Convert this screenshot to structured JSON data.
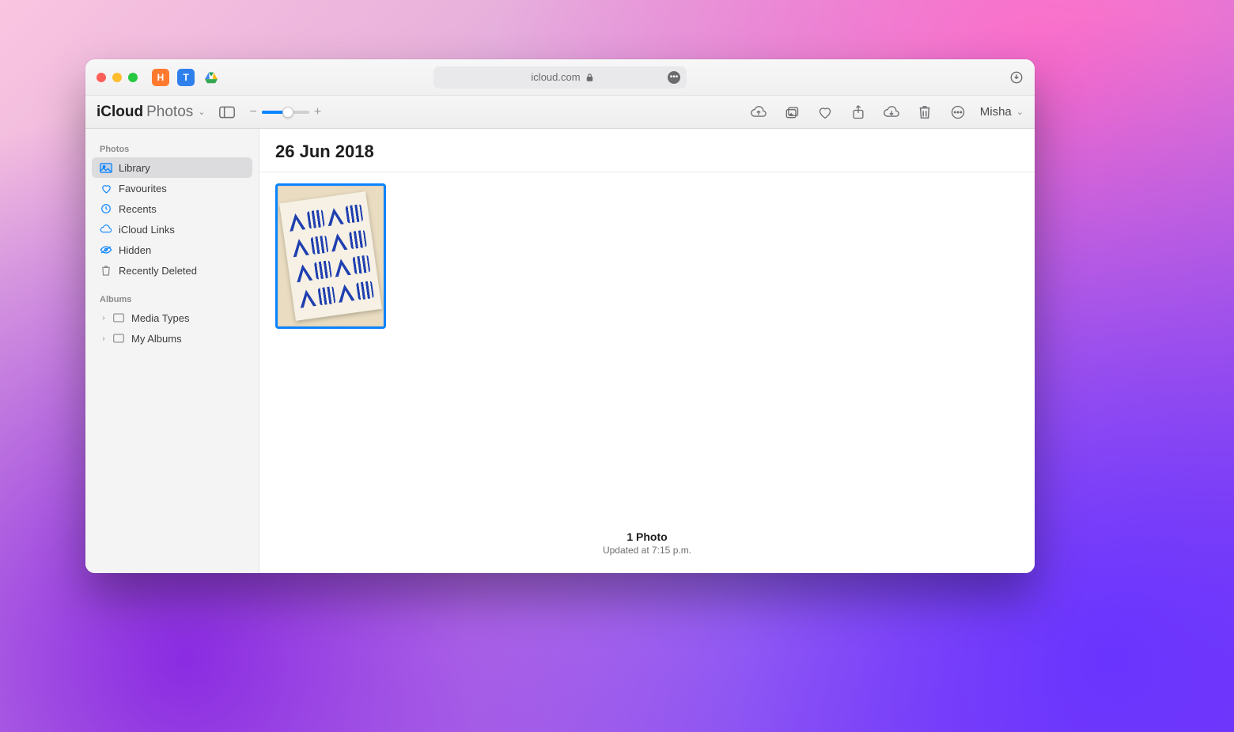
{
  "browser": {
    "url_host": "icloud.com",
    "ext_labels": [
      "H",
      "T"
    ]
  },
  "app": {
    "title_prefix": "iCloud",
    "title_main": "Photos",
    "user_name": "Misha"
  },
  "zoom": {
    "minus": "−",
    "plus": "+"
  },
  "sidebar": {
    "section_photos": "Photos",
    "items": [
      {
        "label": "Library"
      },
      {
        "label": "Favourites"
      },
      {
        "label": "Recents"
      },
      {
        "label": "iCloud Links"
      },
      {
        "label": "Hidden"
      },
      {
        "label": "Recently Deleted"
      }
    ],
    "section_albums": "Albums",
    "albums": [
      {
        "label": "Media Types"
      },
      {
        "label": "My Albums"
      }
    ]
  },
  "main": {
    "date_heading": "26 Jun 2018",
    "photo_count_label": "1 Photo",
    "updated_label": "Updated at 7:15 p.m."
  }
}
